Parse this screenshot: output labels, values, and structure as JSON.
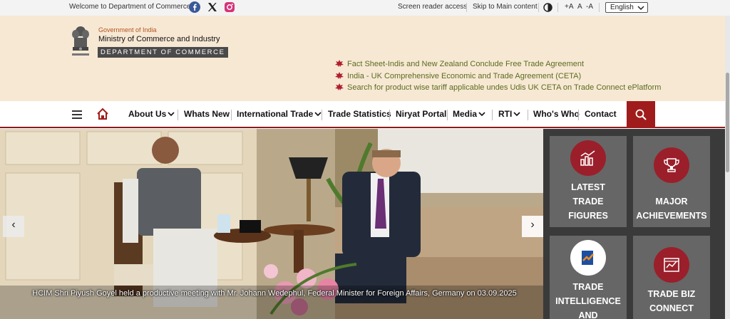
{
  "topbar": {
    "welcome": "Welcome to Department of Commerce",
    "social_icons": [
      "facebook-icon",
      "x-icon",
      "instagram-icon"
    ],
    "screen_reader": "Screen reader access",
    "skip_main": "Skip to Main content",
    "contrast_icon": "contrast-icon",
    "font_increase": "+A",
    "font_normal": "A",
    "font_decrease": "-A",
    "language": "English"
  },
  "header": {
    "gov": "Government of India",
    "ministry": "Ministry of Commerce and Industry",
    "department": "DEPARTMENT OF COMMERCE",
    "news": [
      "Fact Sheet-Indis and New Zealand Conclude Free Trade Agreement",
      "India - UK Comprehensive Economic and Trade Agreement (CETA)",
      "Search for product wise tariff applicable undes Udis UK CETA on Trade Connect ePlatform"
    ]
  },
  "nav": {
    "items": [
      "About Us",
      "Whats New",
      "International Trade",
      "Trade Statistics",
      "Niryat Portal",
      "Media",
      "RTI",
      "Who's Who",
      "Contact"
    ]
  },
  "carousel": {
    "caption": "HCIM Shri Piyush Goyel held a productive meeting with Mr. Johann Wedephul, Federal Minister for Foreign Affairs, Germany on 03.09.2025",
    "prev": "‹",
    "next": "›"
  },
  "tiles": [
    {
      "label1": "LATEST",
      "label2": "TRADE",
      "label3": "FIGURES",
      "icon": "bar-chart-icon"
    },
    {
      "label1": "MAJOR",
      "label2": "ACHIEVEMENTS",
      "icon": "trophy-icon"
    },
    {
      "label1": "TRADE",
      "label2": "INTELLIGENCE",
      "label3": "AND",
      "icon": "trade-intelligence-icon"
    },
    {
      "label1": "TRADE BIZ",
      "label2": "CONNECT",
      "icon": "trade-connect-icon"
    }
  ],
  "colors": {
    "header_bg": "#f7e8d4",
    "brand_red": "#a01c1c",
    "news_green": "#5b6b1e",
    "tile_circle": "#9a1f2a"
  }
}
